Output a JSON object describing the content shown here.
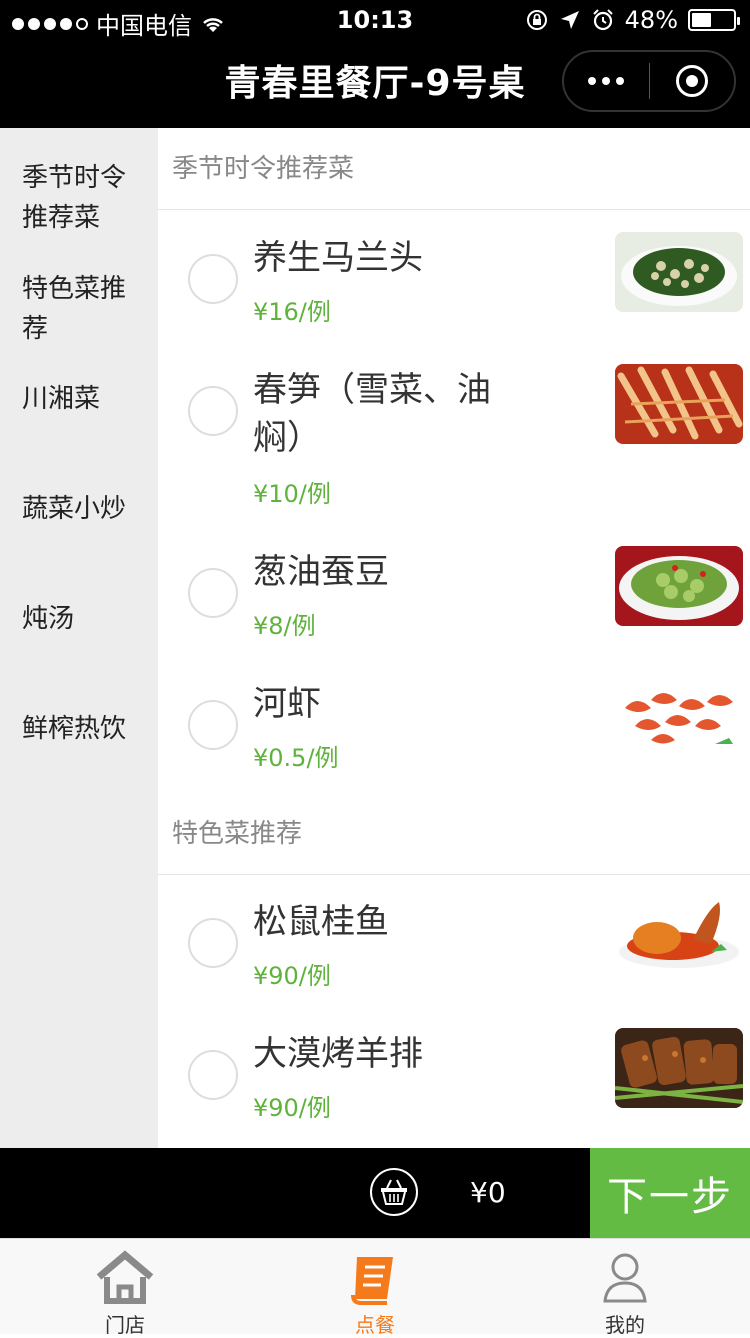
{
  "status_bar": {
    "carrier": "中国电信",
    "time": "10:13",
    "battery_percent": "48%",
    "battery_level": 0.48,
    "icons": [
      "signal-dots-icon",
      "wifi-icon",
      "lock-rotation-icon",
      "location-icon",
      "alarm-icon",
      "battery-icon"
    ]
  },
  "nav": {
    "title": "青春里餐厅-9号桌",
    "icons": [
      "more-icon",
      "close-miniprogram-icon"
    ]
  },
  "sidebar": {
    "items": [
      {
        "label": "季节时令推荐菜"
      },
      {
        "label": "特色菜推荐"
      },
      {
        "label": "川湘菜"
      },
      {
        "label": "蔬菜小炒"
      },
      {
        "label": "炖汤"
      },
      {
        "label": "鲜榨热饮"
      }
    ]
  },
  "sections": [
    {
      "title": "季节时令推荐菜",
      "dishes": [
        {
          "name": "养生马兰头",
          "price": "¥16/例",
          "image": "greens-with-beans"
        },
        {
          "name": "春笋（雪菜、油焖）",
          "price": "¥10/例",
          "image": "braised-bamboo-shoots"
        },
        {
          "name": "葱油蚕豆",
          "price": "¥8/例",
          "image": "broad-beans-bowl"
        },
        {
          "name": "河虾",
          "price": "¥0.5/例",
          "image": "river-shrimp"
        }
      ]
    },
    {
      "title": "特色菜推荐",
      "dishes": [
        {
          "name": "松鼠桂鱼",
          "price": "¥90/例",
          "image": "squirrel-fish"
        },
        {
          "name": "大漠烤羊排",
          "price": "¥90/例",
          "image": "roast-lamb-ribs"
        }
      ]
    }
  ],
  "cart": {
    "total": "¥0",
    "next_label": "下一步",
    "icon": "basket-icon"
  },
  "tabbar": {
    "tabs": [
      {
        "label": "门店",
        "icon": "store-home-icon",
        "active": false
      },
      {
        "label": "点餐",
        "icon": "order-menu-icon",
        "active": true
      },
      {
        "label": "我的",
        "icon": "profile-icon",
        "active": false
      }
    ]
  },
  "colors": {
    "accent_green": "#63bb43",
    "price_green": "#5fb33d",
    "tab_active": "#f57a1c",
    "sidebar_bg": "#ededed"
  }
}
